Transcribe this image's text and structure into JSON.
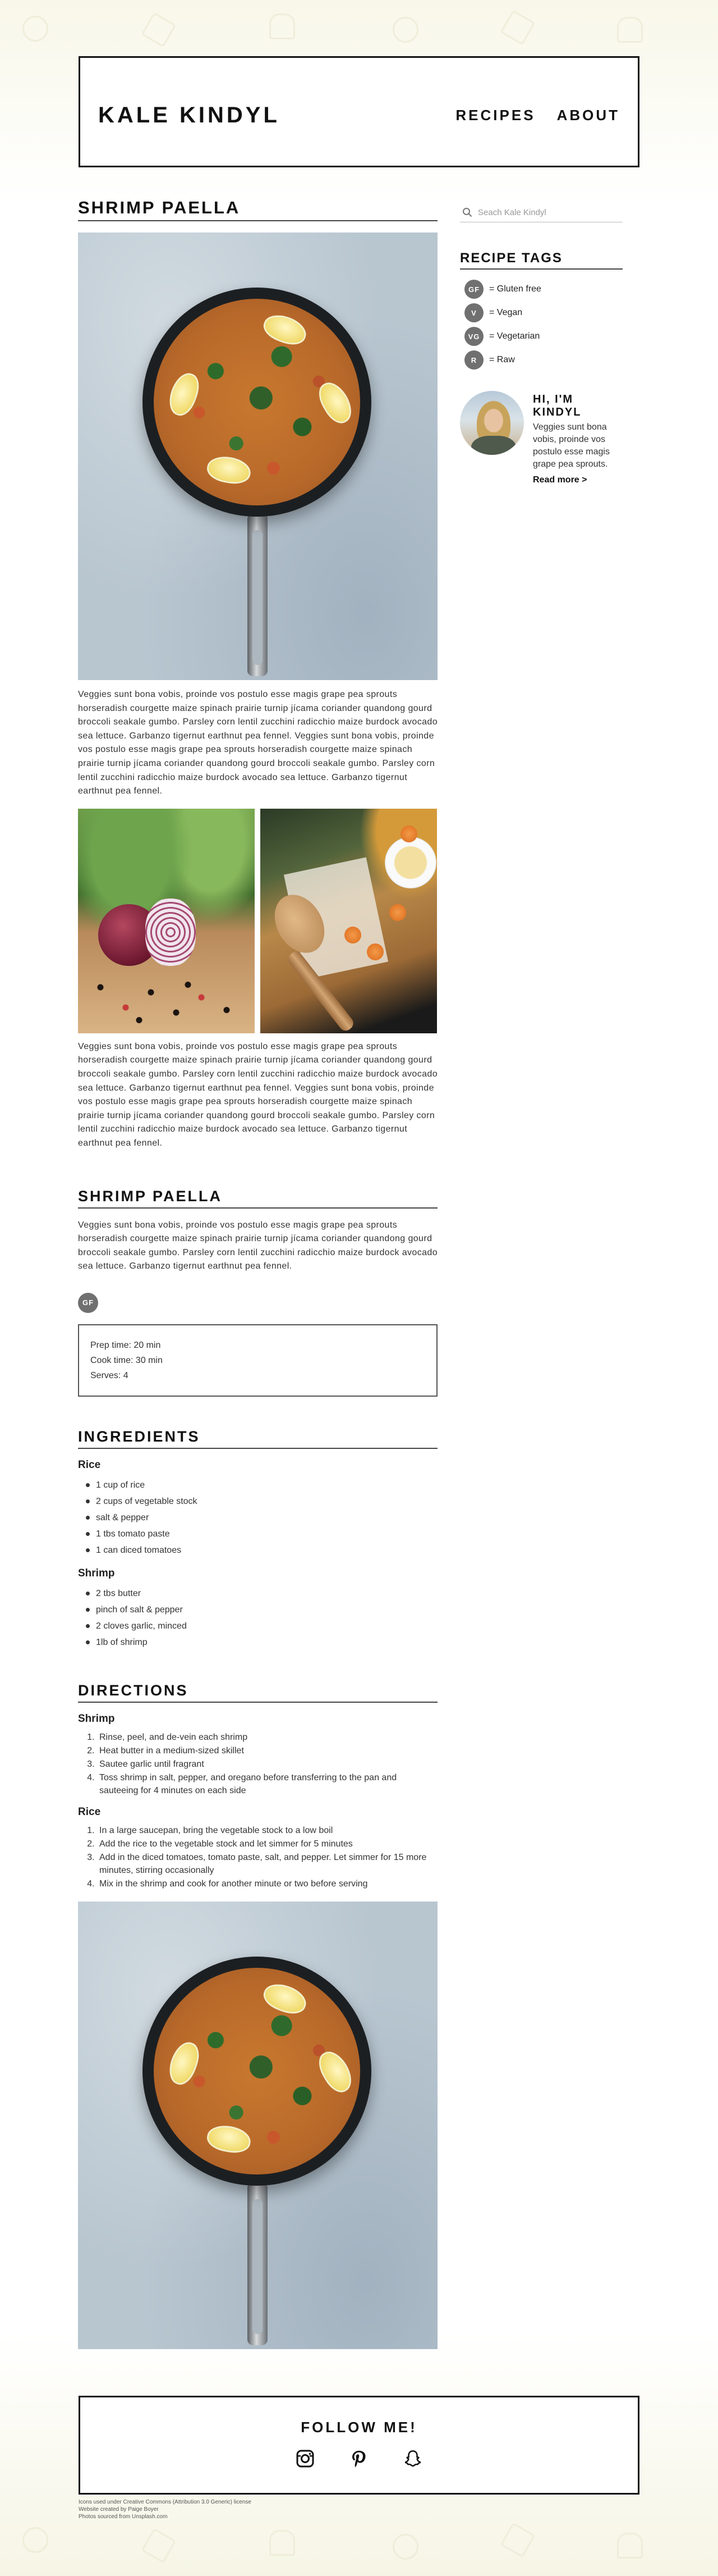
{
  "header": {
    "logo": "KALE KINDYL",
    "nav": [
      "RECIPES",
      "ABOUT"
    ]
  },
  "post": {
    "title": "SHRIMP PAELLA",
    "paragraph_1": "Veggies sunt bona vobis, proinde vos postulo esse magis grape pea sprouts horseradish courgette maize spinach prairie turnip jícama coriander quandong gourd broccoli seakale gumbo. Parsley corn lentil zucchini radicchio maize burdock avocado sea lettuce. Garbanzo tigernut earthnut pea fennel. Veggies sunt bona vobis, proinde vos postulo esse magis grape pea sprouts horseradish courgette maize spinach prairie turnip jícama coriander quandong gourd broccoli seakale gumbo. Parsley corn lentil zucchini radicchio maize burdock avocado sea lettuce. Garbanzo tigernut earthnut pea fennel.",
    "paragraph_2": "Veggies sunt bona vobis, proinde vos postulo esse magis grape pea sprouts horseradish courgette maize spinach prairie turnip jícama coriander quandong gourd broccoli seakale gumbo. Parsley corn lentil zucchini radicchio maize burdock avocado sea lettuce. Garbanzo tigernut earthnut pea fennel. Veggies sunt bona vobis, proinde vos postulo esse magis grape pea sprouts horseradish courgette maize spinach prairie turnip jícama coriander quandong gourd broccoli seakale gumbo. Parsley corn lentil zucchini radicchio maize burdock avocado sea lettuce. Garbanzo tigernut earthnut pea fennel."
  },
  "recipe": {
    "title": "SHRIMP PAELLA",
    "intro": "Veggies sunt bona vobis, proinde vos postulo esse magis grape pea sprouts horseradish courgette maize spinach prairie turnip jícama coriander quandong gourd broccoli seakale gumbo. Parsley corn lentil zucchini radicchio maize burdock avocado sea lettuce. Garbanzo tigernut earthnut pea fennel.",
    "tag": "GF",
    "prep_time": "Prep time: 20 min",
    "cook_time": "Cook time: 30 min",
    "serves": "Serves: 4"
  },
  "ingredients": {
    "title": "INGREDIENTS",
    "groups": [
      {
        "name": "Rice",
        "items": [
          "1 cup of rice",
          "2 cups of vegetable stock",
          "salt & pepper",
          "1 tbs tomato paste",
          "1 can diced tomatoes"
        ]
      },
      {
        "name": "Shrimp",
        "items": [
          "2 tbs butter",
          "pinch of salt & pepper",
          "2 cloves garlic, minced",
          "1lb of shrimp"
        ]
      }
    ]
  },
  "directions": {
    "title": "DIRECTIONS",
    "groups": [
      {
        "name": "Shrimp",
        "steps": [
          "Rinse, peel, and de-vein each shrimp",
          "Heat butter in a medium-sized skillet",
          "Sautee garlic until fragrant",
          "Toss shrimp in salt, pepper, and oregano before transferring to the pan and sauteeing for 4 minutes on each side"
        ]
      },
      {
        "name": "Rice",
        "steps": [
          "In a large saucepan, bring the vegetable stock to a low boil",
          "Add the rice to the vegetable stock and let simmer for 5 minutes",
          "Add in the diced tomatoes, tomato paste, salt, and pepper. Let simmer for 15 more minutes, stirring occasionally",
          "Mix in the shrimp and cook for another minute or two before serving"
        ]
      }
    ]
  },
  "sidebar": {
    "search_placeholder": "Seach Kale Kindyl",
    "tags_title": "RECIPE TAGS",
    "tags": [
      {
        "code": "GF",
        "label": "= Gluten free"
      },
      {
        "code": "V",
        "label": "= Vegan"
      },
      {
        "code": "VG",
        "label": "= Vegetarian"
      },
      {
        "code": "R",
        "label": "= Raw"
      }
    ],
    "about": {
      "title": "HI, I'M KINDYL",
      "text": "Veggies sunt bona vobis, proinde vos postulo esse magis grape pea sprouts.",
      "link": "Read more >"
    }
  },
  "footer": {
    "title": "FOLLOW ME!",
    "social": [
      "instagram-icon",
      "pinterest-icon",
      "snapchat-icon"
    ],
    "notes": [
      "Icons used under Creative Commons (Attribution 3.0 Generic) license",
      "Website created by Paige Boyer",
      "Photos sourced from Unsplash.com"
    ]
  },
  "colors": {
    "accent": "#111111",
    "tag_badge": "#707070",
    "background_tint": "#f8f7e9"
  }
}
